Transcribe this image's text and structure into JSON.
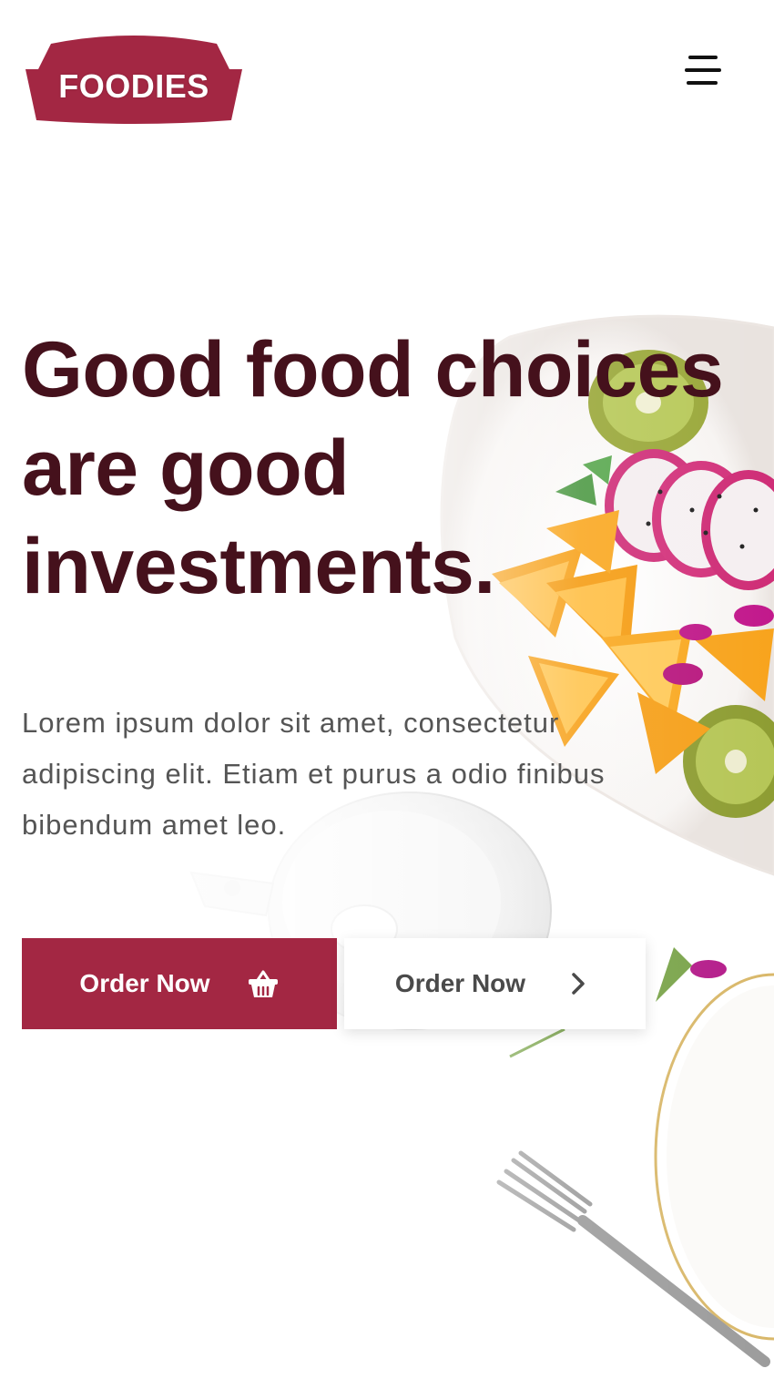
{
  "brand": {
    "name": "FOODIES",
    "color": "#a32743"
  },
  "header": {
    "menu_icon": "hamburger-menu-icon"
  },
  "hero": {
    "title_lines": [
      "Good food choices",
      "are good",
      "investments."
    ],
    "title_color": "#45111c",
    "description": "Lorem ipsum dolor sit amet, consectetur adipiscing elit. Etiam et purus a odio finibus bibendum amet leo."
  },
  "actions": {
    "primary": {
      "label": "Order Now",
      "icon": "shopping-basket-icon",
      "color": "#a32743"
    },
    "secondary": {
      "label": "Order Now",
      "icon": "chevron-right-icon"
    }
  }
}
